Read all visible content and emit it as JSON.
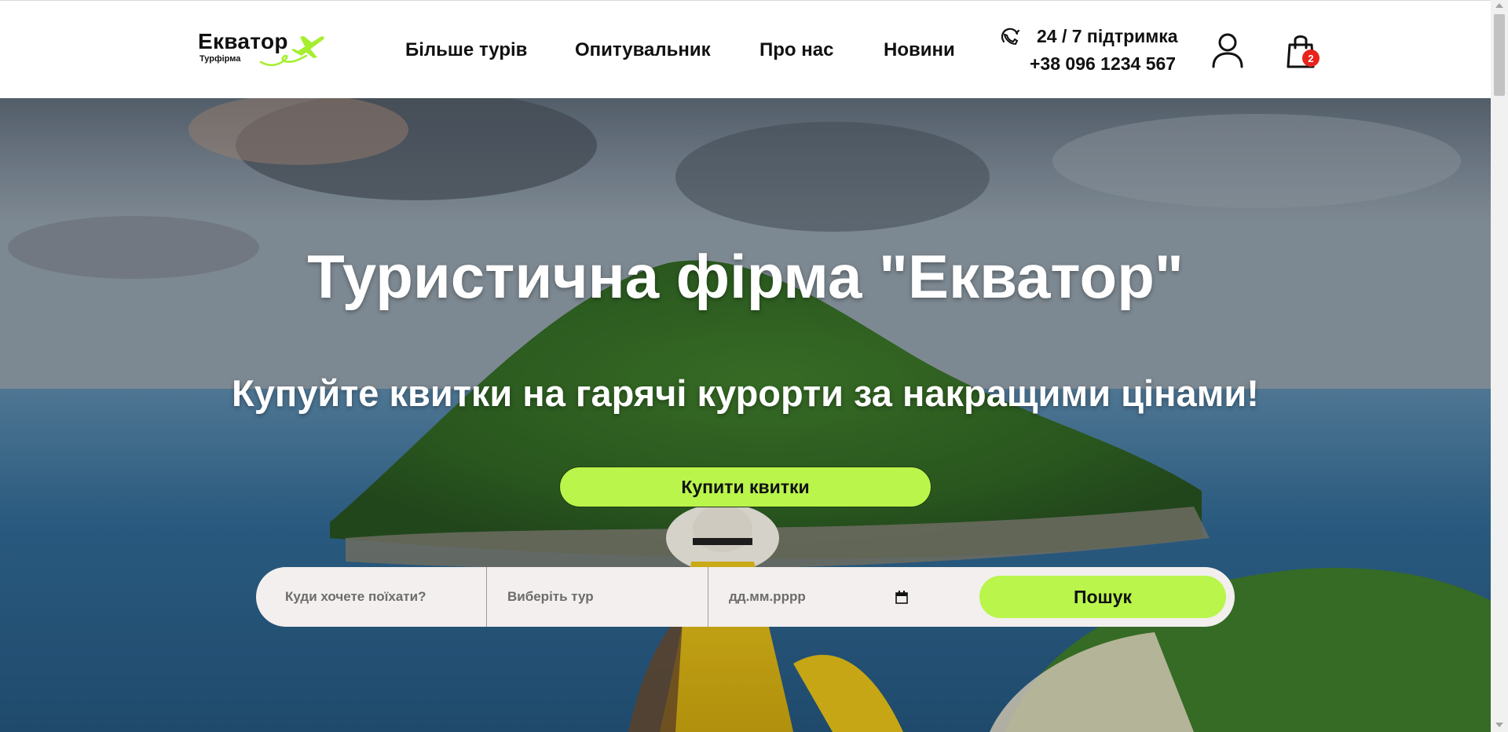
{
  "header": {
    "logo": {
      "title": "Екватор",
      "subtitle": "Турфірма"
    },
    "nav": [
      {
        "label": "Більше турів"
      },
      {
        "label": "Опитувальник"
      },
      {
        "label": "Про нас"
      },
      {
        "label": "Новини"
      }
    ],
    "support": {
      "label": "24 / 7 підтримка",
      "phone": "+38 096 1234 567"
    },
    "cart": {
      "count": "2"
    }
  },
  "hero": {
    "title": "Туристична фірма \"Екватор\"",
    "subtitle": "Купуйте квитки на гарячі курорти за накращими цінами!",
    "buy_button": "Купити квитки",
    "search": {
      "destination_placeholder": "Куди хочете поїхати?",
      "tour_placeholder": "Виберіть тур",
      "date_placeholder": "дд.мм.рррр",
      "submit_label": "Пошук"
    }
  },
  "colors": {
    "accent": "#b9f54b",
    "badge": "#e8231d",
    "text": "#111111",
    "search_bg": "#f2efee"
  },
  "icons": [
    "plane-icon",
    "support-call-icon",
    "user-icon",
    "shopping-bag-icon",
    "calendar-icon"
  ]
}
